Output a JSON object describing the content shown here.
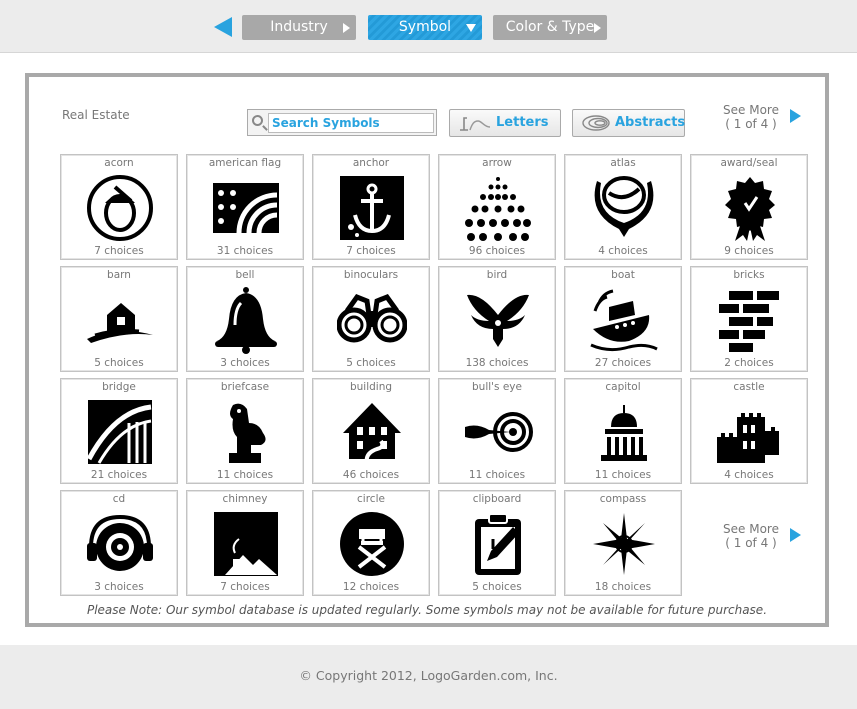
{
  "nav": {
    "tabs": [
      {
        "label": "Industry"
      },
      {
        "label": "Symbol"
      },
      {
        "label": "Color & Type"
      }
    ]
  },
  "panel": {
    "category": "Real Estate",
    "search": {
      "placeholder": "Search Symbols"
    },
    "letters_label": "Letters",
    "abstracts_label": "Abstracts",
    "see_more": {
      "label": "See More",
      "count": "( 1 of 4 )"
    },
    "note": "Please Note: Our symbol database is updated regularly. Some symbols may not be available for future purchase."
  },
  "symbols": [
    {
      "name": "acorn",
      "choices": "7 choices",
      "icon": "acorn-icon"
    },
    {
      "name": "american flag",
      "choices": "31 choices",
      "icon": "american-flag-icon"
    },
    {
      "name": "anchor",
      "choices": "7 choices",
      "icon": "anchor-icon"
    },
    {
      "name": "arrow",
      "choices": "96 choices",
      "icon": "arrow-icon"
    },
    {
      "name": "atlas",
      "choices": "4 choices",
      "icon": "atlas-icon"
    },
    {
      "name": "award/seal",
      "choices": "9 choices",
      "icon": "award-seal-icon"
    },
    {
      "name": "barn",
      "choices": "5 choices",
      "icon": "barn-icon"
    },
    {
      "name": "bell",
      "choices": "3 choices",
      "icon": "bell-icon"
    },
    {
      "name": "binoculars",
      "choices": "5 choices",
      "icon": "binoculars-icon"
    },
    {
      "name": "bird",
      "choices": "138 choices",
      "icon": "bird-icon"
    },
    {
      "name": "boat",
      "choices": "27 choices",
      "icon": "boat-icon"
    },
    {
      "name": "bricks",
      "choices": "2 choices",
      "icon": "bricks-icon"
    },
    {
      "name": "bridge",
      "choices": "21 choices",
      "icon": "bridge-icon"
    },
    {
      "name": "briefcase",
      "choices": "11 choices",
      "icon": "briefcase-icon"
    },
    {
      "name": "building",
      "choices": "46 choices",
      "icon": "building-icon"
    },
    {
      "name": "bull's eye",
      "choices": "11 choices",
      "icon": "bulls-eye-icon"
    },
    {
      "name": "capitol",
      "choices": "11 choices",
      "icon": "capitol-icon"
    },
    {
      "name": "castle",
      "choices": "4 choices",
      "icon": "castle-icon"
    },
    {
      "name": "cd",
      "choices": "3 choices",
      "icon": "cd-icon"
    },
    {
      "name": "chimney",
      "choices": "7 choices",
      "icon": "chimney-icon"
    },
    {
      "name": "circle",
      "choices": "12 choices",
      "icon": "circle-icon"
    },
    {
      "name": "clipboard",
      "choices": "5 choices",
      "icon": "clipboard-icon"
    },
    {
      "name": "compass",
      "choices": "18 choices",
      "icon": "compass-icon"
    }
  ],
  "footer": {
    "copyright": "© Copyright 2012, LogoGarden.com, Inc."
  },
  "colors": {
    "accent": "#29a3df",
    "tab_inactive": "#a8a8a8",
    "panel_border": "#a9a9a9"
  }
}
